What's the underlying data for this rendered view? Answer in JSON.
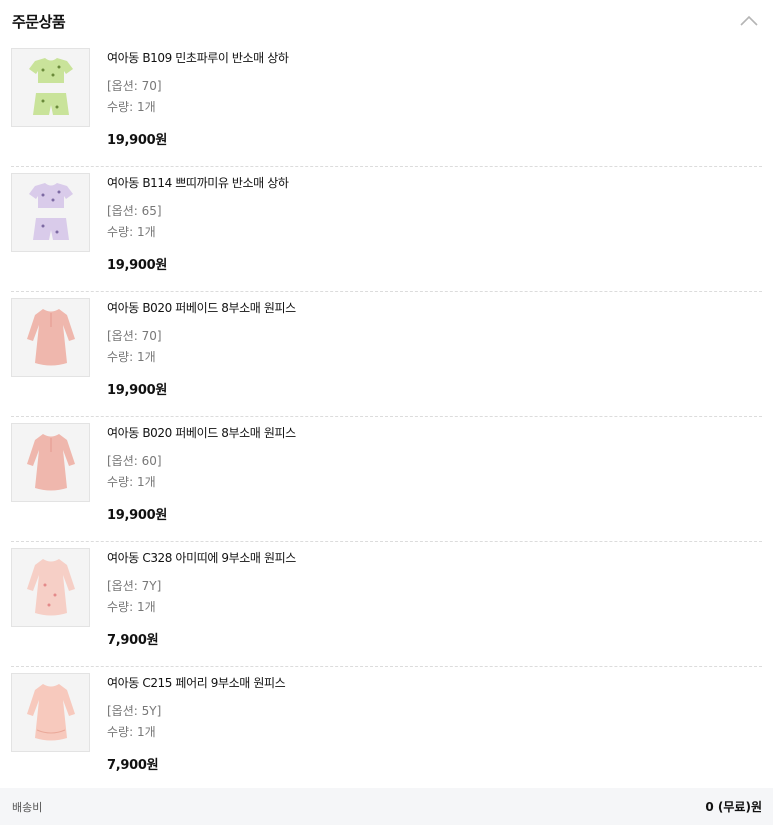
{
  "header": {
    "title": "주문상품",
    "collapse_icon": "chevron-up-icon"
  },
  "items": [
    {
      "name": "여아동 B109 민초파루이 반소매 상하",
      "option": "[옵션: 70]",
      "qty": "수량: 1개",
      "price": "19,900원",
      "thumb": "set-green",
      "color": "#c9e39a"
    },
    {
      "name": "여아동 B114 쁘띠까미유 반소매 상하",
      "option": "[옵션: 65]",
      "qty": "수량: 1개",
      "price": "19,900원",
      "thumb": "set-lilac",
      "color": "#d9cbea"
    },
    {
      "name": "여아동 B020 퍼베이드 8부소매 원피스",
      "option": "[옵션: 70]",
      "qty": "수량: 1개",
      "price": "19,900원",
      "thumb": "dress-pink",
      "color": "#efb7ad"
    },
    {
      "name": "여아동 B020 퍼베이드 8부소매 원피스",
      "option": "[옵션: 60]",
      "qty": "수량: 1개",
      "price": "19,900원",
      "thumb": "dress-pink",
      "color": "#efb7ad"
    },
    {
      "name": "여아동 C328 아미띠에 9부소매 원피스",
      "option": "[옵션: 7Y]",
      "qty": "수량: 1개",
      "price": "7,900원",
      "thumb": "dress-light-pink",
      "color": "#f6cfc6"
    },
    {
      "name": "여아동 C215 페어리 9부소매 원피스",
      "option": "[옵션: 5Y]",
      "qty": "수량: 1개",
      "price": "7,900원",
      "thumb": "dress-light-pink",
      "color": "#f7c9bd"
    }
  ],
  "shipping": {
    "label": "배송비",
    "value": "0 (무료)원"
  }
}
